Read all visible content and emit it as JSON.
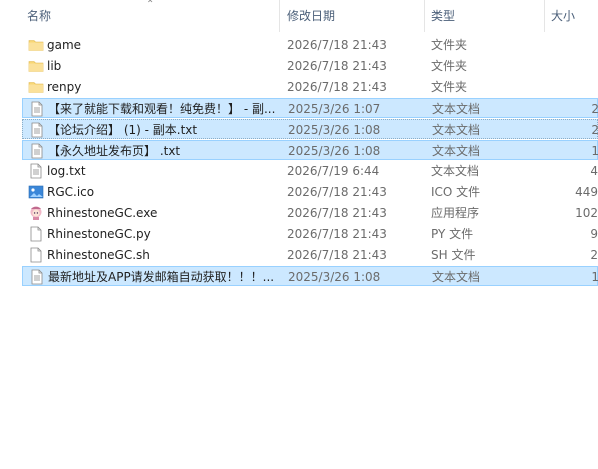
{
  "columns": {
    "name": "名称",
    "date": "修改日期",
    "type": "类型",
    "size": "大小"
  },
  "files": [
    {
      "name": "game",
      "date": "2026/7/18 21:43",
      "type": "文件夹",
      "size": "",
      "icon": "folder-icon",
      "selected": false
    },
    {
      "name": "lib",
      "date": "2026/7/18 21:43",
      "type": "文件夹",
      "size": "",
      "icon": "folder-icon",
      "selected": false
    },
    {
      "name": "renpy",
      "date": "2026/7/18 21:43",
      "type": "文件夹",
      "size": "",
      "icon": "folder-icon",
      "selected": false
    },
    {
      "name": "【来了就能下载和观看！纯免费！】 - 副...",
      "date": "2025/3/26 1:07",
      "type": "文本文档",
      "size": "2",
      "icon": "text-file-icon",
      "selected": true
    },
    {
      "name": "【论坛介绍】 (1) - 副本.txt",
      "date": "2025/3/26 1:08",
      "type": "文本文档",
      "size": "2",
      "icon": "text-file-icon",
      "selected": true
    },
    {
      "name": "【永久地址发布页】 .txt",
      "date": "2025/3/26 1:08",
      "type": "文本文档",
      "size": "1",
      "icon": "text-file-icon",
      "selected": true
    },
    {
      "name": "log.txt",
      "date": "2026/7/19 6:44",
      "type": "文本文档",
      "size": "4",
      "icon": "text-file-icon",
      "selected": false
    },
    {
      "name": "RGC.ico",
      "date": "2026/7/18 21:43",
      "type": "ICO 文件",
      "size": "449",
      "icon": "image-icon",
      "selected": false
    },
    {
      "name": "RhinestoneGC.exe",
      "date": "2026/7/18 21:43",
      "type": "应用程序",
      "size": "102",
      "icon": "app-icon",
      "selected": false
    },
    {
      "name": "RhinestoneGC.py",
      "date": "2026/7/18 21:43",
      "type": "PY 文件",
      "size": "9",
      "icon": "blank-file-icon",
      "selected": false
    },
    {
      "name": "RhinestoneGC.sh",
      "date": "2026/7/18 21:43",
      "type": "SH 文件",
      "size": "2",
      "icon": "blank-file-icon",
      "selected": false
    },
    {
      "name": "最新地址及APP请发邮箱自动获取！！！...",
      "date": "2025/3/26 1:08",
      "type": "文本文档",
      "size": "1",
      "icon": "text-file-icon",
      "selected": true
    }
  ],
  "colors": {
    "selection": "#cce8ff",
    "selection_border": "#99d1ff",
    "folder": "#f8d775",
    "header_text": "#4c607a"
  }
}
